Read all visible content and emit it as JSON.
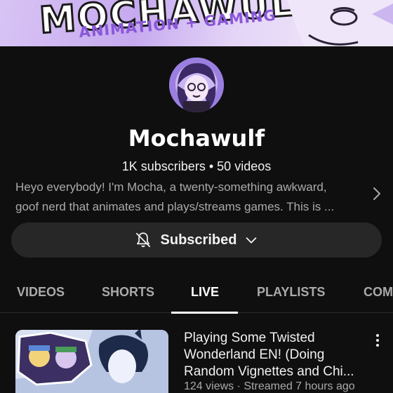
{
  "banner": {
    "logo_text": "MOCHAWULF",
    "tagline": "ANIMATION + GAMING"
  },
  "channel": {
    "name": "Mochawulf",
    "subscribers": "1K subscribers",
    "separator": "•",
    "videos": "50 videos",
    "description_line1": "Heyo everybody! I'm Mocha, a twenty-something awkward,",
    "description_line2": "goof nerd that animates and plays/streams games. This is ..."
  },
  "subscribe": {
    "label": "Subscribed",
    "bell_icon": "bell-off-icon",
    "chevron_icon": "chevron-down-icon"
  },
  "tabs": [
    {
      "label": "VIDEOS",
      "active": false
    },
    {
      "label": "SHORTS",
      "active": false
    },
    {
      "label": "LIVE",
      "active": true
    },
    {
      "label": "PLAYLISTS",
      "active": false
    },
    {
      "label": "COM",
      "active": false
    }
  ],
  "videos": [
    {
      "title_line1": "Playing Some Twisted",
      "title_line2": "Wonderland EN! (Doing",
      "title_line3": "Random Vignettes and Chi...",
      "meta": "124 views · Streamed 7 hours ago"
    }
  ],
  "colors": {
    "background": "#0f0f0f",
    "surface": "#272727",
    "text_primary": "#f1f1f1",
    "text_secondary": "#aaaaaa",
    "accent_purple": "#8a57d9"
  }
}
